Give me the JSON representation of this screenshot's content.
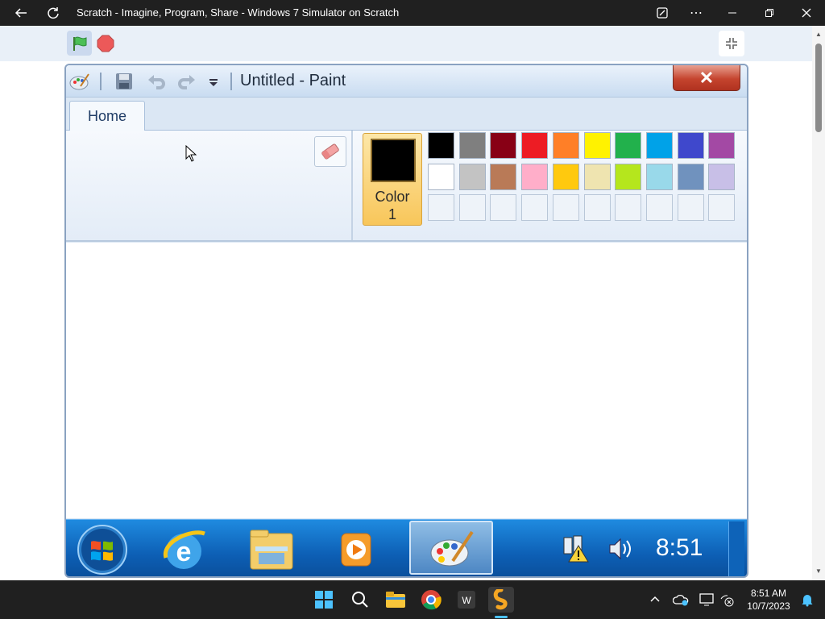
{
  "app": {
    "title": "Scratch - Imagine, Program, Share - Windows 7 Simulator on Scratch"
  },
  "paint": {
    "window_title": "Untitled - Paint",
    "tabs": [
      {
        "label": "Home"
      }
    ],
    "color1_label_line1": "Color",
    "color1_label_line2": "1",
    "color1_value": "#000000",
    "palette_row1": [
      "#000000",
      "#7f7f7f",
      "#880015",
      "#ed1c24",
      "#ff7f27",
      "#fff200",
      "#22b14c",
      "#00a2e8",
      "#3f48cc",
      "#a349a4"
    ],
    "palette_row2": [
      "#ffffff",
      "#c3c3c3",
      "#b97a57",
      "#ffaec9",
      "#ffc90e",
      "#efe4b0",
      "#b5e61d",
      "#99d9ea",
      "#7092be",
      "#c8bfe7"
    ]
  },
  "win7": {
    "clock": "8:51"
  },
  "host": {
    "time": "8:51 AM",
    "date": "10/7/2023"
  },
  "colors": {
    "accent": "#0d5fb5",
    "scratch_toolbar": "#e9f0f8"
  }
}
